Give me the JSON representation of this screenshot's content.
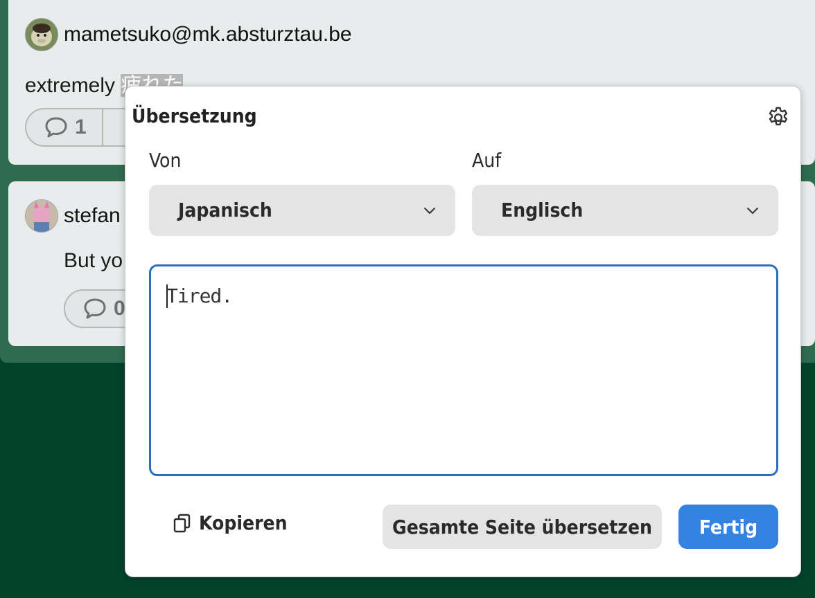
{
  "post1": {
    "author": "mametsuko@mk.absturztau.be",
    "content_prefix": "extremely ",
    "content_selected": "疲れた",
    "reply_count": "1"
  },
  "post2": {
    "author": "stefan",
    "content": "But yo",
    "reply_count": "0"
  },
  "dialog": {
    "title": "Übersetzung",
    "from_label": "Von",
    "to_label": "Auf",
    "from_value": "Japanisch",
    "to_value": "Englisch",
    "output_text": "Tired.",
    "copy_label": "Kopieren",
    "translate_page_label": "Gesamte Seite übersetzen",
    "done_label": "Fertig"
  },
  "colors": {
    "page_background": "#03432c",
    "accent_blue": "#3384e2",
    "focus_border": "#2c6fc1"
  },
  "icons": [
    "avatar",
    "speech-bubble-icon",
    "gear-icon",
    "chevron-down-icon",
    "copy-icon"
  ]
}
